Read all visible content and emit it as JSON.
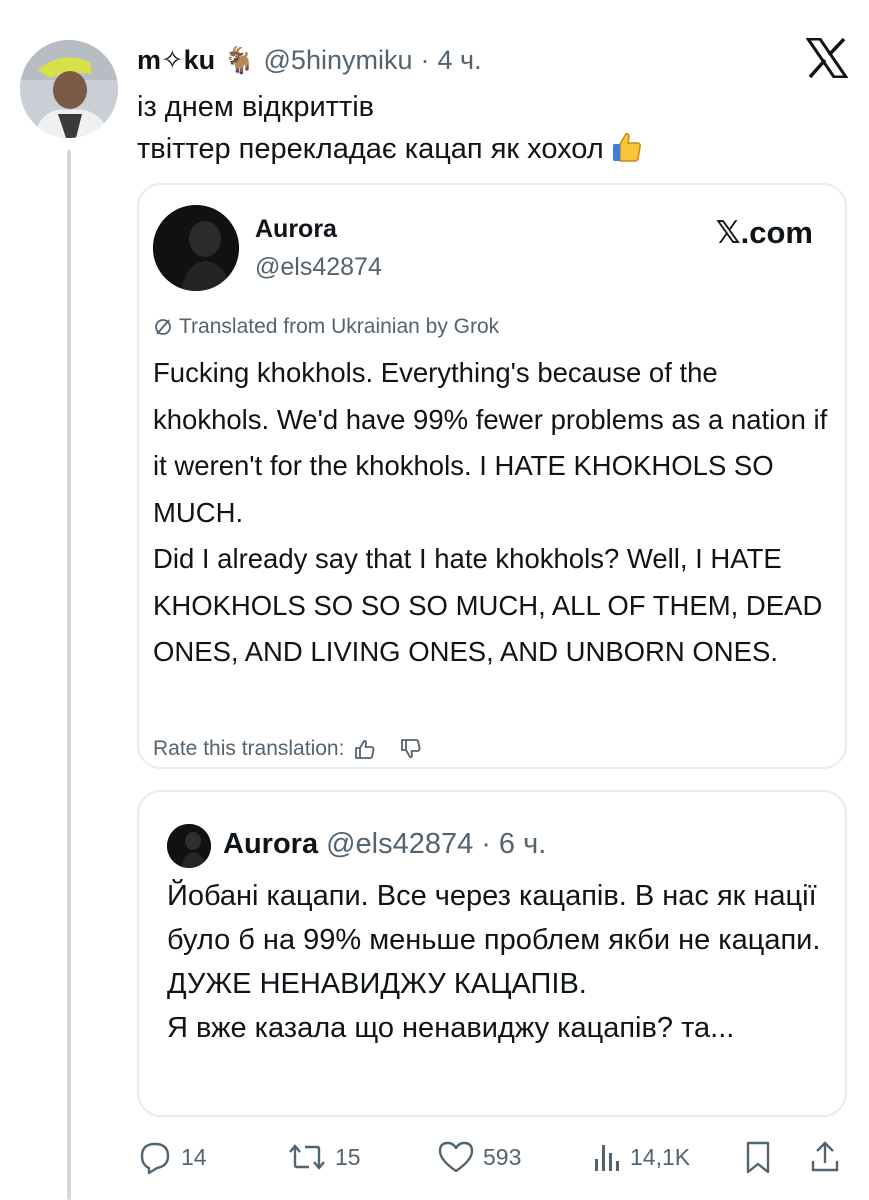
{
  "tweet": {
    "display_name": "m✧ku",
    "goat_emoji": "🐐",
    "handle": "@5hinymiku",
    "dot": "·",
    "time": "4 ч.",
    "text_line1": "із днем відкриттів",
    "text_line2": "твіттер перекладає кацап як хохол"
  },
  "quote_card": {
    "display_name": "Aurora",
    "handle": "@els42874",
    "site": "𝕏.com",
    "translated_label": "Translated from Ukrainian by Grok",
    "paragraph1": "Fucking khokhols. Everything's because of the khokhols. We'd have 99% fewer problems as a nation if it weren't for the khokhols. I HATE KHOKHOLS SO MUCH.",
    "paragraph2": "Did I already say that I hate khokhols? Well, I HATE KHOKHOLS SO SO SO MUCH, ALL OF THEM, DEAD ONES, AND LIVING ONES, AND UNBORN ONES.",
    "rate_label": "Rate this translation:"
  },
  "original_quote": {
    "display_name": "Aurora",
    "handle": "@els42874",
    "dot": "·",
    "time": "6 ч.",
    "paragraph1": "Йобані кацапи. Все через кацапів. В нас як нації було б на 99% меньше проблем якби не кацапи. ДУЖЕ НЕНАВИДЖУ КАЦАПІВ.",
    "paragraph2": "Я вже казала що ненавиджу кацапів? та..."
  },
  "actions": {
    "replies": "14",
    "retweets": "15",
    "likes": "593",
    "views": "14,1K"
  },
  "icons": {
    "close": "x-logo-icon",
    "reply": "reply-icon",
    "retweet": "retweet-icon",
    "like": "heart-icon",
    "views": "views-icon",
    "bookmark": "bookmark-icon",
    "share": "share-icon",
    "thumbs_up": "thumbs-up-icon",
    "thumbs_down": "thumbs-down-icon",
    "translate": "grok-icon"
  },
  "colors": {
    "text_primary": "#0f1419",
    "text_secondary": "#536471",
    "border": "#e7ecf0",
    "thread_line": "#cfd9de"
  }
}
